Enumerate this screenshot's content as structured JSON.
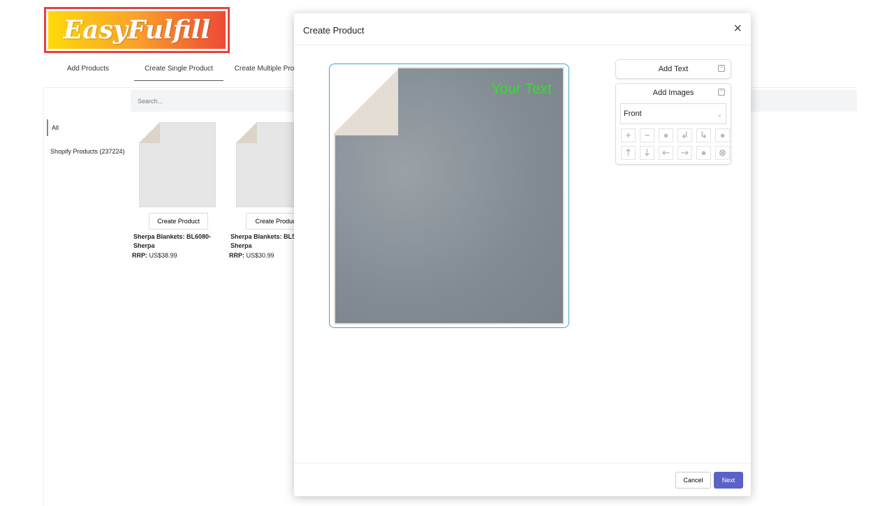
{
  "logo": {
    "text": "EasyFulfill"
  },
  "tabs": [
    {
      "label": "Add Products"
    },
    {
      "label": "Create Single Product"
    },
    {
      "label": "Create Multiple Produ"
    }
  ],
  "search": {
    "placeholder": "Search..."
  },
  "sidebar": {
    "items": [
      {
        "label": "All"
      },
      {
        "label": "Shopify Products (237224)"
      }
    ]
  },
  "products": [
    {
      "button": "Create Product",
      "title": "Sherpa Blankets: BL6080-Sherpa",
      "rrp_label": "RRP:",
      "price": "US$38.99"
    },
    {
      "button": "Create Produc",
      "title": "Sherpa Blankets: BL5",
      "title2": "Sherpa",
      "rrp_label": "RRP:",
      "price": "US$30.99"
    }
  ],
  "modal": {
    "title": "Create Product",
    "canvas_text": "Your Text",
    "add_text": "Add Text",
    "add_images": "Add Images",
    "view_select": "Front",
    "cancel": "Cancel",
    "next": "Next",
    "text_color": "#31e02a"
  },
  "tool_icons": [
    "plus-icon",
    "minus-icon",
    "circle-icon",
    "rotate-left-icon",
    "rotate-right-icon",
    "circle-icon",
    "move-up-icon",
    "move-down-icon",
    "move-left-icon",
    "move-right-icon",
    "circle-icon",
    "delete-icon"
  ]
}
